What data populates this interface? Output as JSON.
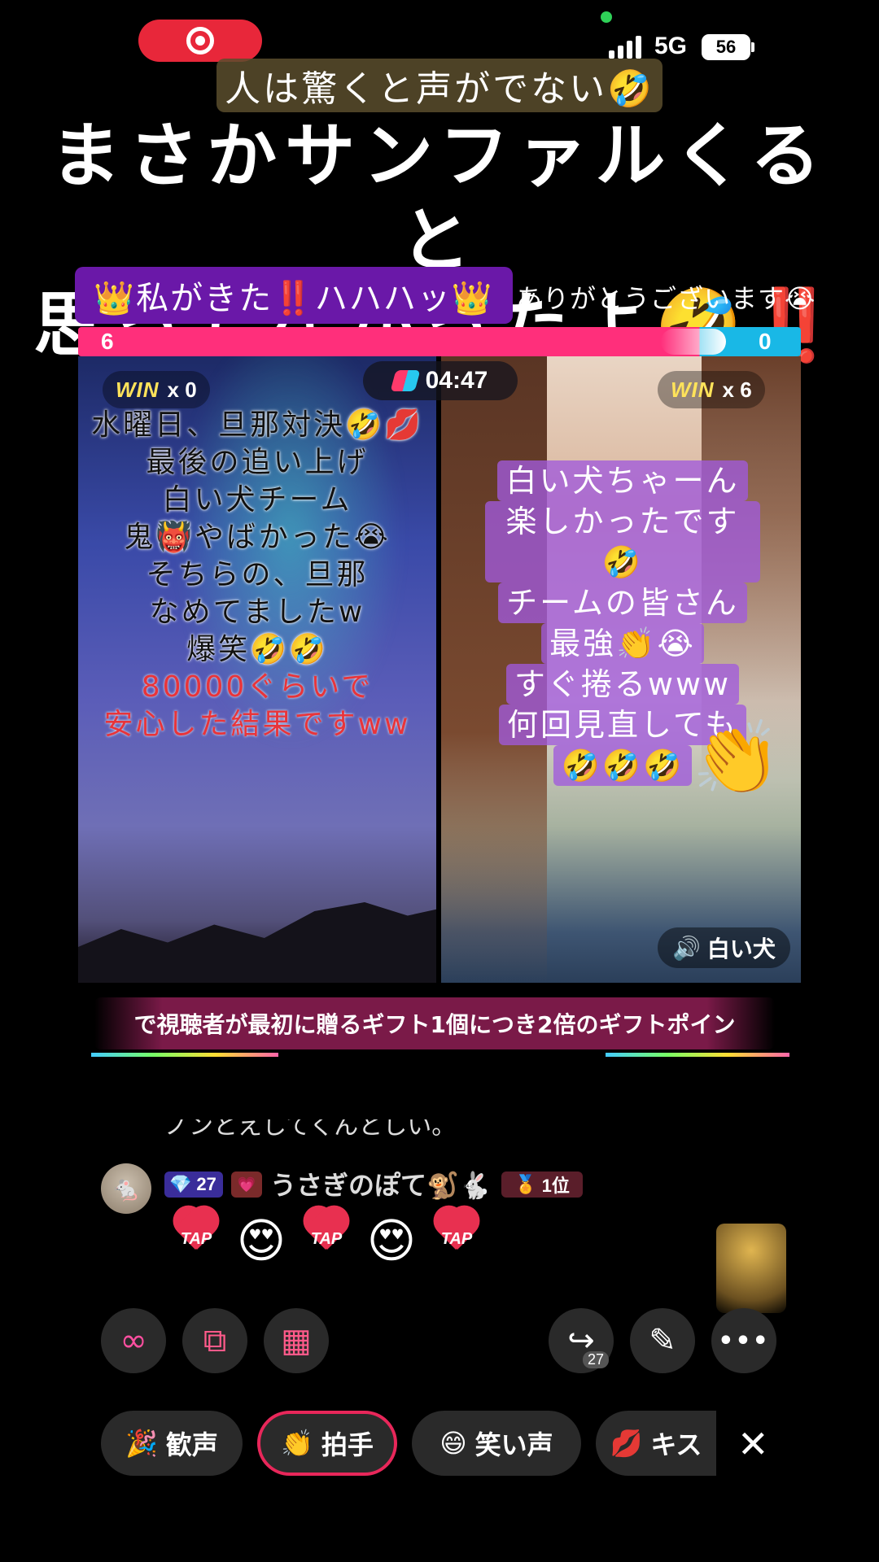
{
  "status_bar": {
    "network": "5G",
    "battery": "56"
  },
  "captions": {
    "top": "人は驚くと声がでない🤣",
    "headline_line1": "まさかサンファルくると",
    "headline_line2": "思ってなかったよ🤣‼️",
    "crown_banner": "👑私がきた‼️ハハハッ👑",
    "thanks": "ありがとうございます😭"
  },
  "battle": {
    "score_left": "6",
    "score_right": "0",
    "timer": "04:47",
    "win_label": "WIN",
    "left_wins": "x 0",
    "right_wins": "x 6",
    "left_lines": [
      "水曜日、旦那対決🤣💋",
      "最後の追い上げ",
      "白い犬チーム",
      "鬼👹やばかった😭",
      "そちらの、旦那",
      "なめてましたw",
      "爆笑🤣🤣"
    ],
    "left_red_lines": [
      "80000ぐらいで",
      "安心した結果ですww"
    ],
    "right_lines": [
      "白い犬ちゃーん",
      "楽しかったです🤣",
      "チームの皆さん",
      "最強👏😭",
      "すぐ捲るwww",
      "何回見直しても",
      "🤣🤣🤣"
    ],
    "right_host": "白い犬"
  },
  "promo_text": "で視聴者が最初に贈るギフト1個につき2倍のギフトポイン",
  "comments": {
    "cut_line": "ノンとえしてくんとしい。",
    "user": {
      "diamond_level": "27",
      "name": "うさぎのぽて🐒🐇",
      "rank": "1位"
    },
    "tap_label": "TAP"
  },
  "actions": {
    "share_count": "27"
  },
  "reactions": [
    {
      "icon": "🎉",
      "label": "歓声"
    },
    {
      "icon": "👏",
      "label": "拍手"
    },
    {
      "icon": "😄",
      "label": "笑い声"
    },
    {
      "icon": "💋",
      "label": "キス"
    }
  ],
  "colors": {
    "team_left": "#ff2f7b",
    "team_right": "#19b8e6",
    "live_red": "#e8273a"
  }
}
